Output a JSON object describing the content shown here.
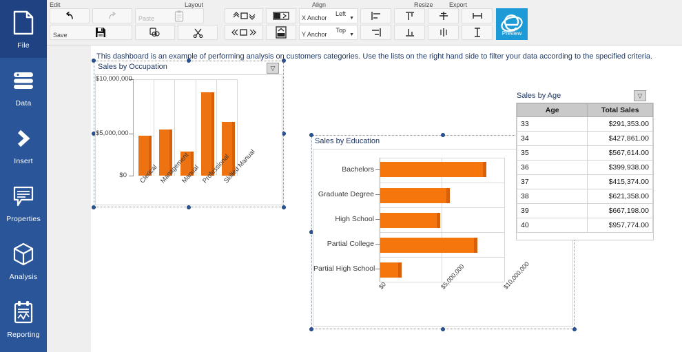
{
  "sidebar": {
    "items": [
      {
        "label": "File",
        "icon": "document-icon",
        "selected": true
      },
      {
        "label": "Data",
        "icon": "database-icon",
        "selected": false
      },
      {
        "label": "Insert",
        "icon": "chevron-right-icon",
        "selected": false
      },
      {
        "label": "Properties",
        "icon": "speech-bubble-icon",
        "selected": false
      },
      {
        "label": "Analysis",
        "icon": "cube-icon",
        "selected": false
      },
      {
        "label": "Reporting",
        "icon": "clipboard-chart-icon",
        "selected": false
      }
    ]
  },
  "toolbar": {
    "groups": [
      {
        "name": "Edit"
      },
      {
        "name": "Layout"
      },
      {
        "name": "Align"
      },
      {
        "name": "Resize"
      },
      {
        "name": "Export"
      }
    ],
    "edit": {
      "undo_label": "",
      "redo_label": "",
      "paste_label": "Paste",
      "save_label": "Save",
      "copy_label": "",
      "cut_label": ""
    },
    "layout": {
      "x_anchor_key": "X Anchor",
      "x_anchor_value": "Left",
      "y_anchor_key": "Y Anchor",
      "y_anchor_value": "Top"
    },
    "export": {
      "preview_label": "Preview"
    }
  },
  "description": "This dashboard is an example of performing analysis on customers categories. Use the lists on the right hand side to filter your data according to the specified criteria.",
  "panels": {
    "occupation_title": "Sales by Occupation",
    "education_title": "Sales by Education",
    "age_title": "Sales by Age"
  },
  "table": {
    "headers": [
      "Age",
      "Total Sales"
    ],
    "rows": [
      [
        "33",
        "$291,353.00"
      ],
      [
        "34",
        "$427,861.00"
      ],
      [
        "35",
        "$567,614.00"
      ],
      [
        "36",
        "$399,938.00"
      ],
      [
        "37",
        "$415,374.00"
      ],
      [
        "38",
        "$621,358.00"
      ],
      [
        "39",
        "$667,198.00"
      ],
      [
        "40",
        "$957,774.00"
      ]
    ]
  },
  "chart_data": [
    {
      "type": "bar",
      "title": "Sales by Occupation",
      "orientation": "vertical",
      "categories": [
        "Clerical",
        "Management",
        "Manual",
        "Professional",
        "Skilled Manual"
      ],
      "values": [
        4750000,
        5500000,
        2900000,
        9900000,
        6400000
      ],
      "ticks": [
        "$0",
        "$5,000,000",
        "$10,000,000"
      ],
      "tick_values": [
        0,
        5000000,
        10000000
      ],
      "ylim": [
        0,
        11500000
      ],
      "xlabel": "",
      "ylabel": "",
      "grid": true,
      "series_color": "#ed7211",
      "legend": "none"
    },
    {
      "type": "bar",
      "title": "Sales by Education",
      "orientation": "horizontal",
      "categories": [
        "Bachelors",
        "Graduate Degree",
        "High School",
        "Partial College",
        "Partial High School"
      ],
      "values": [
        8500000,
        5600000,
        4800000,
        7800000,
        1700000
      ],
      "ticks": [
        "$0",
        "$5,000,000",
        "$10,000,000"
      ],
      "tick_values": [
        0,
        5000000,
        10000000
      ],
      "xlim": [
        0,
        10000000
      ],
      "xlabel": "",
      "ylabel": "",
      "grid": true,
      "series_color": "#f4760d",
      "legend": "none"
    },
    {
      "type": "table",
      "title": "Sales by Age",
      "columns": [
        "Age",
        "Total Sales"
      ],
      "rows": [
        [
          "33",
          "$291,353.00"
        ],
        [
          "34",
          "$427,861.00"
        ],
        [
          "35",
          "$567,614.00"
        ],
        [
          "36",
          "$399,938.00"
        ],
        [
          "37",
          "$415,374.00"
        ],
        [
          "38",
          "$621,358.00"
        ],
        [
          "39",
          "$667,198.00"
        ],
        [
          "40",
          "$957,774.00"
        ]
      ]
    }
  ],
  "colors": {
    "sidebar": "#2a5699",
    "sidebar_selected": "#1f4282",
    "accent_orange": "#ed7211",
    "accent_orange_dark": "#d95f08",
    "ie_blue": "#1d9bd7",
    "text_blue": "#1f3864"
  }
}
